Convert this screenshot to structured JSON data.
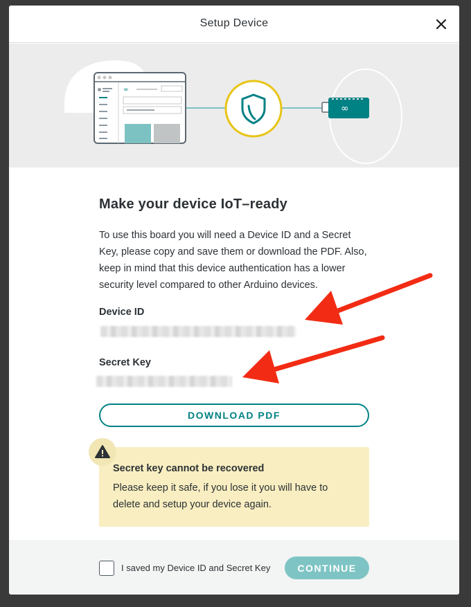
{
  "modal": {
    "title": "Setup Device",
    "close_icon": "close-icon"
  },
  "hero": {
    "icons": [
      "browser-window-illustration",
      "shield-icon",
      "arduino-board-illustration"
    ],
    "colors": {
      "teal": "#008184",
      "yellow": "#e8c416",
      "line": "#7dc2c3"
    }
  },
  "content": {
    "heading": "Make your device IoT–ready",
    "description": "To use this board you will need a Device ID and a Secret Key, please copy and save them or download the PDF. Also, keep in mind that this device authentication has a lower security level compared to other Arduino devices.",
    "device_id_label": "Device ID",
    "secret_key_label": "Secret Key",
    "download_label": "DOWNLOAD PDF"
  },
  "warning": {
    "icon": "warning-icon",
    "title": "Secret key cannot be recovered",
    "text": "Please keep it safe, if you lose it you will have to delete and setup your device again."
  },
  "footer": {
    "checkbox_label": "I saved my Device ID and Secret Key",
    "checkbox_checked": false,
    "continue_label": "CONTINUE"
  },
  "annotations": {
    "arrow_color": "#f22c14",
    "arrows": [
      "arrow-to-device-id",
      "arrow-to-secret-key"
    ]
  }
}
